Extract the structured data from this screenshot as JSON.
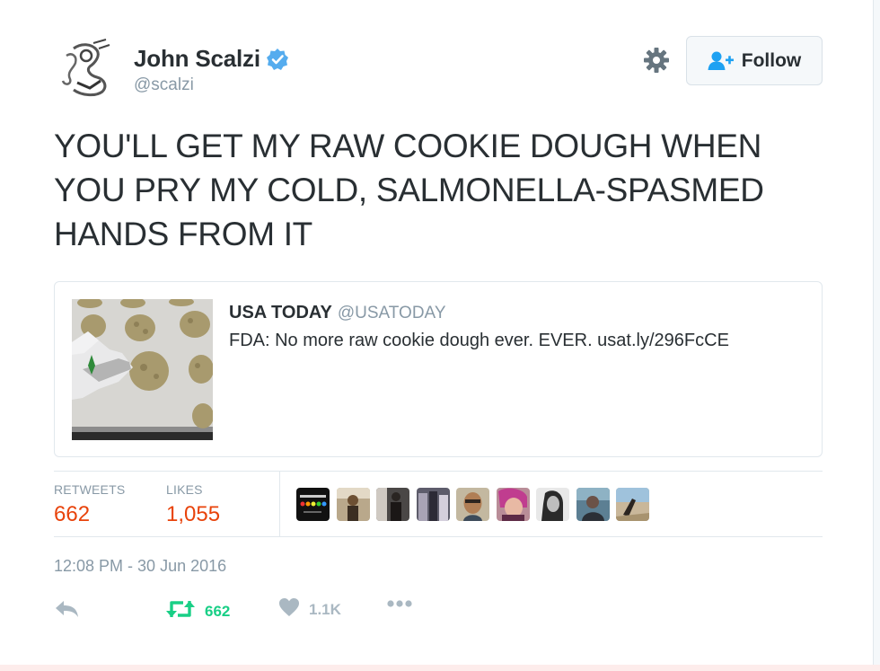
{
  "author": {
    "display_name": "John Scalzi",
    "handle": "@scalzi",
    "verified": true,
    "verified_color": "#55acee"
  },
  "follow_button": {
    "label": "Follow"
  },
  "tweet": {
    "lines": [
      "YOU'LL GET MY RAW COOKIE DOUGH WHEN",
      "YOU PRY MY COLD, SALMONELLA-SPASMED",
      "HANDS FROM IT"
    ]
  },
  "quoted_tweet": {
    "display_name": "USA TODAY",
    "handle": "@USATODAY",
    "text": "FDA: No more raw cookie dough ever. EVER. usat.ly/296FcCE"
  },
  "stats": {
    "retweets_label": "RETWEETS",
    "retweets_value": "662",
    "likes_label": "LIKES",
    "likes_value": "1,055",
    "value_color": "#e8430b",
    "liker_count": 9
  },
  "timestamp": "12:08 PM - 30 Jun 2016",
  "actions": {
    "reply_icon": "reply-icon",
    "retweet_icon": "retweet-icon",
    "retweet_count": "662",
    "retweet_color": "#19cf86",
    "like_icon": "heart-icon",
    "like_count": "1.1K",
    "more_icon": "more-icon",
    "muted_color": "#aab8c2"
  }
}
